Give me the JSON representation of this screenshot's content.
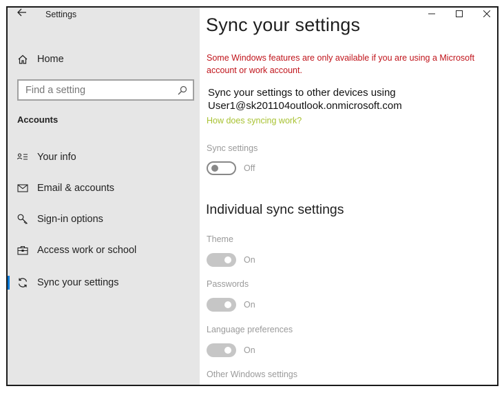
{
  "window": {
    "title": "Settings"
  },
  "sidebar": {
    "home_label": "Home",
    "search_placeholder": "Find a setting",
    "section_title": "Accounts",
    "items": [
      {
        "label": "Your info",
        "icon": "person-card-icon"
      },
      {
        "label": "Email & accounts",
        "icon": "envelope-icon"
      },
      {
        "label": "Sign-in options",
        "icon": "key-icon"
      },
      {
        "label": "Access work or school",
        "icon": "briefcase-icon"
      },
      {
        "label": "Sync your settings",
        "icon": "sync-icon",
        "active": true
      }
    ]
  },
  "main": {
    "title": "Sync your settings",
    "warning": "Some Windows features are only available if you are using a Microsoft account or work account.",
    "description": "Sync your settings to other devices using User1@sk201104outlook.onmicrosoft.com",
    "help_link": "How does syncing work?",
    "sync_settings": {
      "label": "Sync settings",
      "state": "Off"
    },
    "individual_heading": "Individual sync settings",
    "individual": [
      {
        "label": "Theme",
        "state": "On"
      },
      {
        "label": "Passwords",
        "state": "On"
      },
      {
        "label": "Language preferences",
        "state": "On"
      },
      {
        "label": "Other Windows settings"
      }
    ]
  },
  "colors": {
    "accent": "#0078d7",
    "warning": "#c0141b",
    "link": "#a8c232",
    "sidebar_bg": "#e6e6e6"
  }
}
